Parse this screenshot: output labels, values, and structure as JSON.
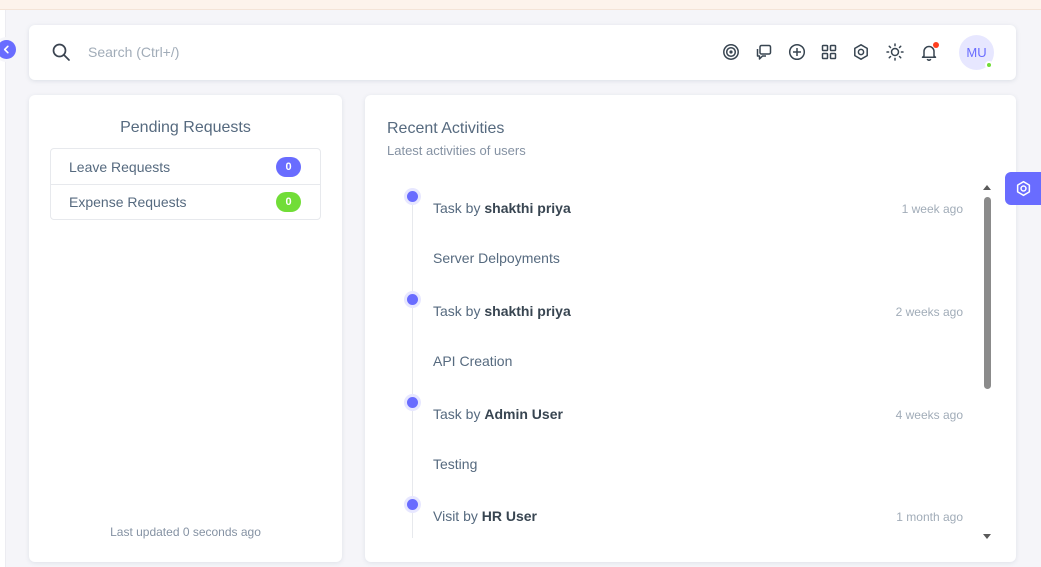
{
  "colors": {
    "primary": "#696cff",
    "success": "#71dd37",
    "danger": "#ff3e1d",
    "text": "#566a7f",
    "muted": "#a1acb8"
  },
  "search": {
    "placeholder": "Search (Ctrl+/)"
  },
  "navbar": {
    "icons": [
      "target-icon",
      "chat-icon",
      "add-circle-icon",
      "apps-grid-icon",
      "settings-icon",
      "theme-sun-icon",
      "notification-bell-icon"
    ],
    "avatar_initials": "MU"
  },
  "pending": {
    "title": "Pending Requests",
    "items": [
      {
        "label": "Leave Requests",
        "count": "0",
        "color": "#696cff"
      },
      {
        "label": "Expense Requests",
        "count": "0",
        "color": "#71dd37"
      }
    ],
    "last_updated": "Last updated 0 seconds ago"
  },
  "activities": {
    "title": "Recent Activities",
    "subtitle": "Latest activities of users",
    "items": [
      {
        "type": "Task by",
        "user": "shakthi priya",
        "time": "1 week ago",
        "description": "Server Delpoyments"
      },
      {
        "type": "Task by",
        "user": "shakthi priya",
        "time": "2 weeks ago",
        "description": "API Creation"
      },
      {
        "type": "Task by",
        "user": "Admin User",
        "time": "4 weeks ago",
        "description": "Testing"
      },
      {
        "type": "Visit by",
        "user": "HR User",
        "time": "1 month ago",
        "description": ""
      }
    ]
  }
}
